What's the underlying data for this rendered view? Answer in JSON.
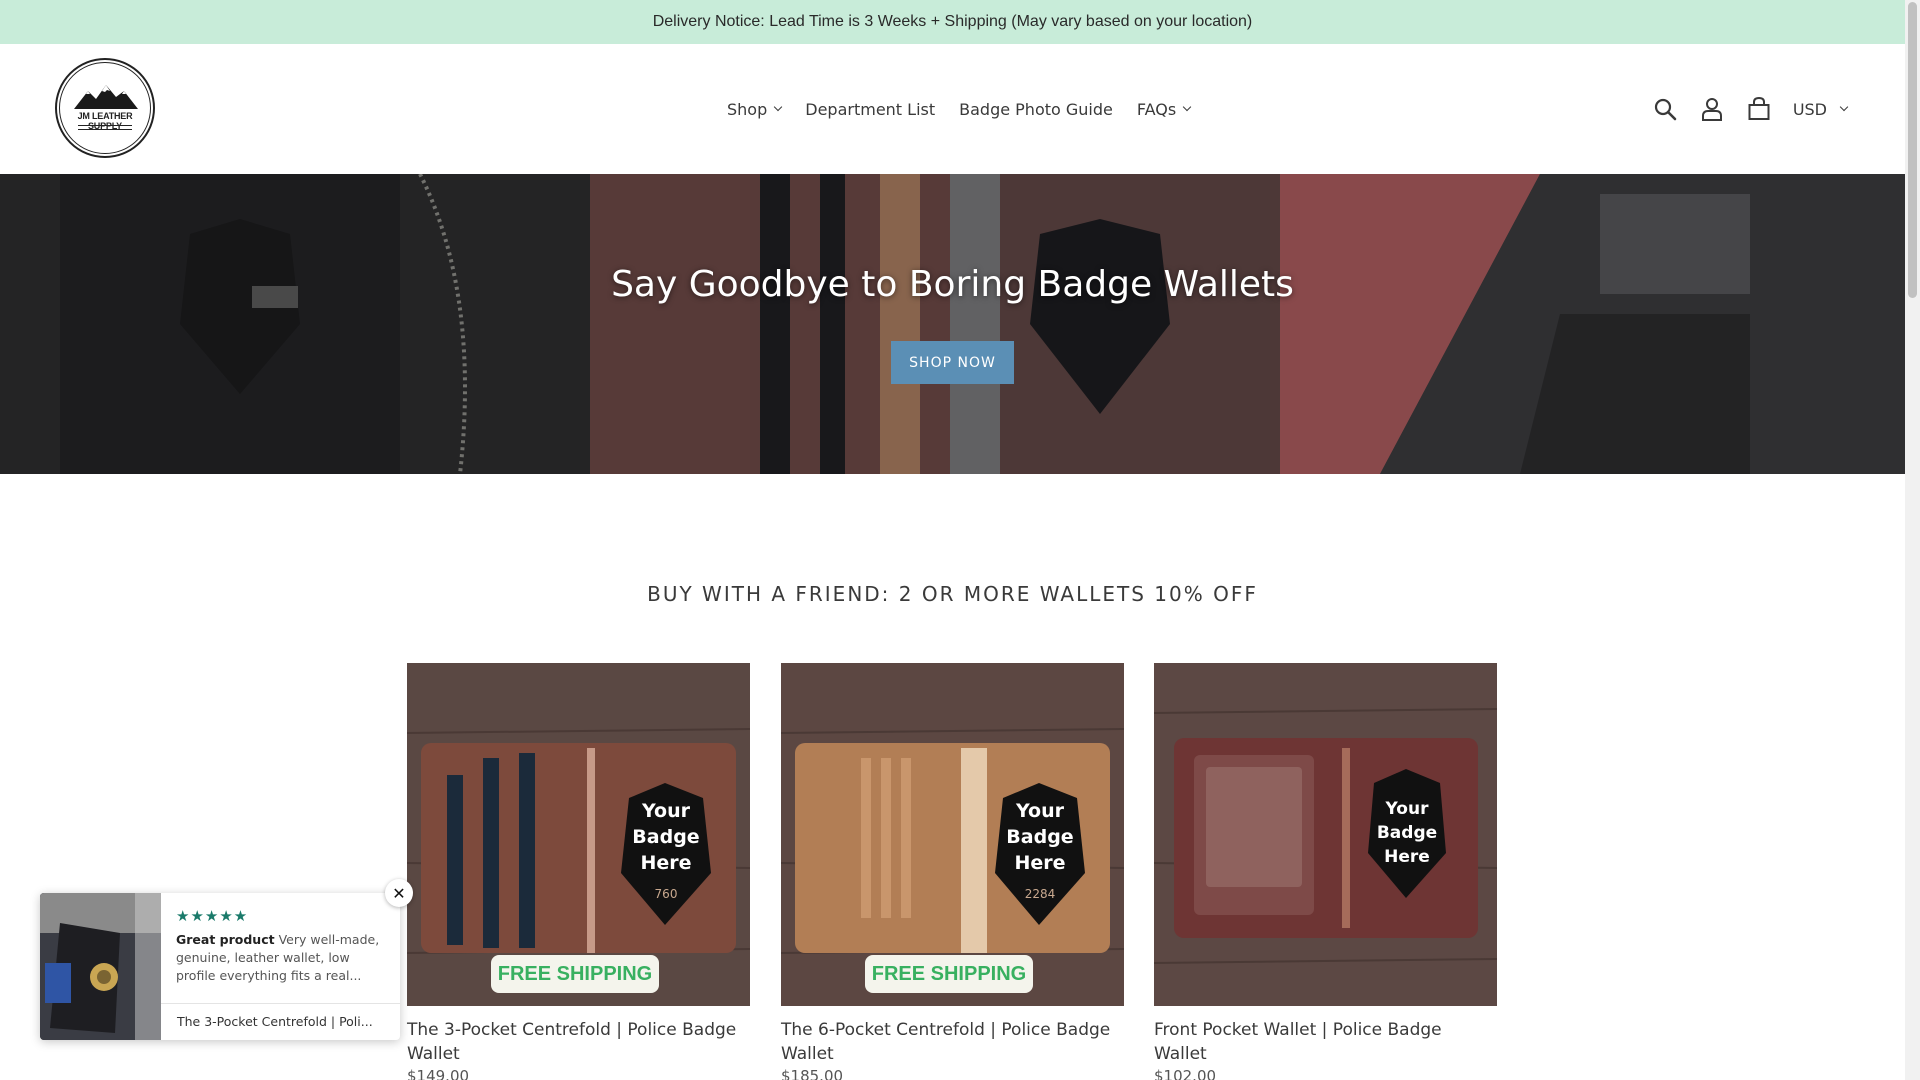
{
  "announcement": {
    "text": "Delivery Notice: Lead Time is 3 Weeks + Shipping (May vary based on your location)"
  },
  "header": {
    "logo_text": "JM LEATHER SUPPLY",
    "nav": [
      {
        "label": "Shop",
        "has_dropdown": true
      },
      {
        "label": "Department List",
        "has_dropdown": false
      },
      {
        "label": "Badge Photo Guide",
        "has_dropdown": false
      },
      {
        "label": "FAQs",
        "has_dropdown": true
      }
    ],
    "icons": [
      "search-icon",
      "account-icon",
      "cart-icon"
    ],
    "currency": "USD"
  },
  "hero": {
    "title": "Say Goodbye to Boring Badge Wallets",
    "button_label": "SHOP NOW"
  },
  "collection": {
    "title": "BUY WITH A FRIEND: 2 OR MORE WALLETS 10% OFF",
    "products": [
      {
        "name": "The 3-Pocket Centrefold | Police Badge Wallet",
        "price": "$149.00",
        "badge_text": "Your Badge Here",
        "badge_number": "760",
        "promo": "FREE SHIPPING"
      },
      {
        "name": "The 6-Pocket Centrefold | Police Badge Wallet",
        "price": "$185.00",
        "badge_text": "Your Badge Here",
        "badge_number": "2284",
        "promo": "FREE SHIPPING"
      },
      {
        "name": "Front Pocket Wallet | Police Badge Wallet",
        "price": "$102.00",
        "badge_text": "Your Badge Here",
        "badge_number": "",
        "promo": ""
      }
    ]
  },
  "review_popup": {
    "stars": "★★★★★",
    "title": "Great product",
    "body": "Very well-made, genuine, leather wallet, low profile everything fits a real...",
    "product": "The 3-Pocket Centrefold | Poli...",
    "close_label": "✕"
  },
  "colors": {
    "announcement_bg": "#c8ecd9",
    "button_blue": "#5b8fb5",
    "star_green": "#1a7a6a",
    "free_shipping_green": "#38b060"
  }
}
